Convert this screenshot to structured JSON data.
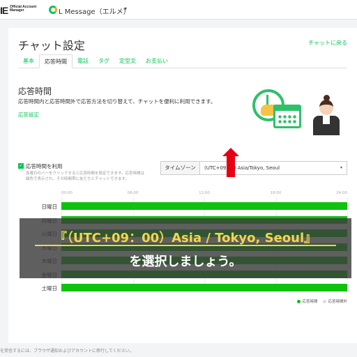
{
  "header": {
    "logo_mark": "IE",
    "logo_sub": "Official Account Manager",
    "account_name": "L Message（エルメ）",
    "caret": "▾"
  },
  "page": {
    "title": "チャット設定",
    "back_link": "チャットに戻る",
    "tabs": [
      {
        "label": "基本",
        "active": false
      },
      {
        "label": "応答時間",
        "active": true
      },
      {
        "label": "電話",
        "active": false
      },
      {
        "label": "タグ",
        "active": false
      },
      {
        "label": "定型文",
        "active": false
      },
      {
        "label": "お支払い",
        "active": false
      }
    ]
  },
  "section": {
    "title": "応答時間",
    "description": "応答時間内と応答時間外で応答方法を切り替えて、チャットを便利に利用できます。",
    "link": "応答設定"
  },
  "settings": {
    "checkbox_label": "応答時間を利用",
    "checkbox_checked": true,
    "hint": "各曜日のバーをクリックすると応答時間を設定できます。応答時間は\n緑色で表示され、その時間帯に友だちとチャットできます。",
    "timezone_label": "タイムゾーン",
    "timezone_value": "(UTC+09:00) Asia/Tokyo, Seoul"
  },
  "schedule": {
    "ticks": [
      "00:00",
      "06:00",
      "12:00",
      "18:00",
      "24:00"
    ],
    "days": [
      {
        "label": "日曜日",
        "hours_fraction": 1.0
      },
      {
        "label": "月曜日",
        "hours_fraction": 1.0
      },
      {
        "label": "火曜日",
        "hours_fraction": 1.0
      },
      {
        "label": "水曜日",
        "hours_fraction": 1.0
      },
      {
        "label": "木曜日",
        "hours_fraction": 1.0
      },
      {
        "label": "金曜日",
        "hours_fraction": 1.0
      },
      {
        "label": "土曜日",
        "hours_fraction": 1.0
      }
    ],
    "legend": [
      {
        "label": "応答時間",
        "color": "#0ec20e"
      },
      {
        "label": "応答時間外",
        "color": "#dddddd"
      }
    ]
  },
  "footer": {
    "text": "を受信するには、ブラウザ通知およびアカウントに移行してください。"
  },
  "overlay": {
    "line1": "『（UTC+09：00）Asia / Tokyo, Seoul』",
    "line2": "を選択しましょう。"
  },
  "colors": {
    "accent": "#06c755",
    "bar": "#0ec20e",
    "arrow": "#e60012",
    "caption_highlight": "#f2d64b"
  }
}
